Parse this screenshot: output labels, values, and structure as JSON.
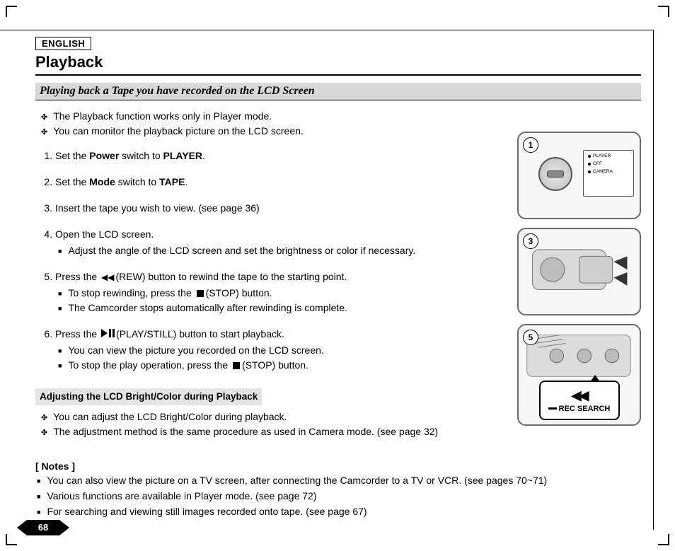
{
  "lang": "ENGLISH",
  "title": "Playback",
  "subtitle": "Playing back a Tape you have recorded on the LCD Screen",
  "intro": [
    "The Playback function works only in Player mode.",
    "You can monitor the playback picture on the LCD screen."
  ],
  "steps": {
    "s1a": "Set the ",
    "s1b": "Power",
    "s1c": " switch to ",
    "s1d": "PLAYER",
    "s1e": ".",
    "s2a": "Set the ",
    "s2b": "Mode",
    "s2c": " switch to ",
    "s2d": "TAPE",
    "s2e": ".",
    "s3": "Insert the tape you wish to view. (see page 36)",
    "s4": "Open the LCD screen.",
    "s4_1": "Adjust the angle of the LCD screen and set the brightness or color if necessary.",
    "s5a": "Press the ",
    "s5b": "(REW) button to rewind the tape to the starting point.",
    "s5_1a": "To stop rewinding, press the ",
    "s5_1b": "(STOP) button.",
    "s5_2": "The Camcorder stops automatically after rewinding is complete.",
    "s6a": "Press the ",
    "s6b": "(PLAY/STILL) button to start playback.",
    "s6_1": "You can view the picture you recorded on the LCD screen.",
    "s6_2a": "To stop the play operation, press the ",
    "s6_2b": "(STOP) button."
  },
  "sub_heading": "Adjusting the LCD Bright/Color during Playback",
  "sub_points": [
    "You can adjust the LCD Bright/Color during playback.",
    "The adjustment method is the same procedure as used in Camera mode. (see page 32)"
  ],
  "notes_label": "[ Notes ]",
  "notes": [
    "You can also view the picture on a TV screen, after connecting the Camcorder to a TV or VCR. (see pages 70~71)",
    "Various functions are available in Player mode. (see page 72)",
    "For searching and viewing still images recorded onto tape. (see page 67)"
  ],
  "figures": {
    "f1": "1",
    "f3": "3",
    "f5": "5",
    "switch": {
      "player": "PLAYER",
      "off": "OFF",
      "camera": "CAMERA"
    },
    "rec_search": "REC SEARCH"
  },
  "page_number": "68"
}
